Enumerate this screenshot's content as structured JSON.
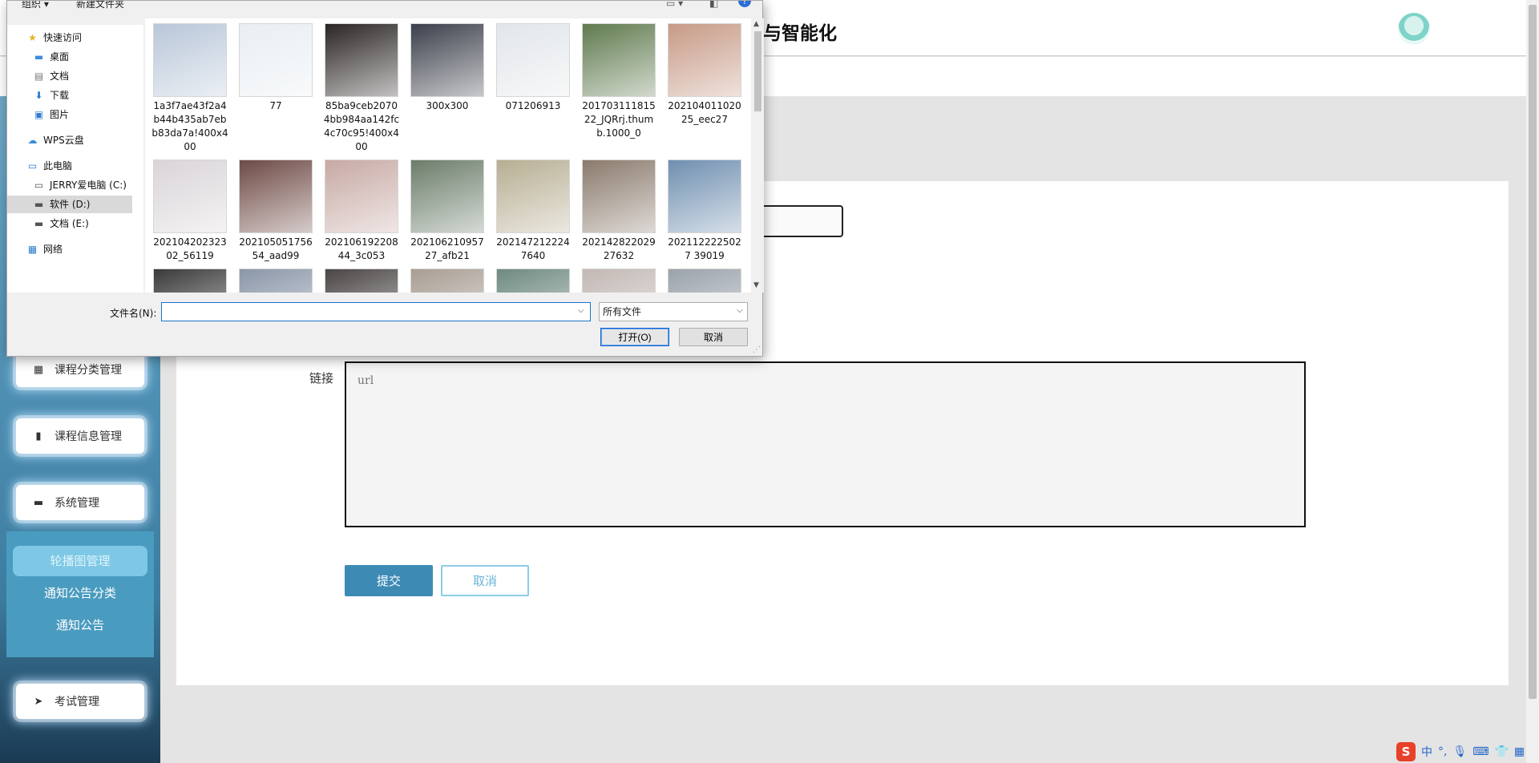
{
  "page": {
    "app_title": "与智能化"
  },
  "sidebar": {
    "items": [
      {
        "label": "课程分类管理",
        "icon": "grid-icon"
      },
      {
        "label": "课程信息管理",
        "icon": "bar-chart-icon"
      },
      {
        "label": "系统管理",
        "icon": "monitor-icon"
      },
      {
        "label": "考试管理",
        "icon": "paper-plane-icon"
      }
    ],
    "submenu": [
      {
        "label": "轮播图管理",
        "active": true
      },
      {
        "label": "通知公告分类",
        "active": false
      },
      {
        "label": "通知公告",
        "active": false
      }
    ]
  },
  "form": {
    "link_label": "链接",
    "link_placeholder": "url",
    "submit_label": "提交",
    "cancel_label": "取消"
  },
  "dialog": {
    "toolbar": {
      "organize": "组织 ▾",
      "new_folder": "新建文件夹"
    },
    "nav": {
      "quick_access": "快速访问",
      "desktop": "桌面",
      "documents": "文档",
      "downloads": "下载",
      "pictures": "图片",
      "wps_cloud": "WPS云盘",
      "this_pc": "此电脑",
      "drive_c": "JERRY爱电脑 (C:)",
      "drive_d": "软件 (D:)",
      "drive_e": "文档 (E:)",
      "network": "网络"
    },
    "files": [
      {
        "name": "1a3f7ae43f2a4b44b435ab7ebb83da7a!400x400",
        "color": "#b9c7d9"
      },
      {
        "name": "77",
        "color": "#e8eef2"
      },
      {
        "name": "85ba9ceb20704bb984aa142fc4c70c95!400x400",
        "color": "#2a2424"
      },
      {
        "name": "300x300",
        "color": "#3b3f4a"
      },
      {
        "name": "071206913",
        "color": "#e2e6ea"
      },
      {
        "name": "20170311181522_JQRrj.thumb.1000_0",
        "color": "#5f7a4e"
      },
      {
        "name": "20210401102025_eec27",
        "color": "#c79a86"
      },
      {
        "name": "20210420232302_56119",
        "color": "#d9d4d8"
      },
      {
        "name": "20210505175654_aad99",
        "color": "#6e4a45"
      },
      {
        "name": "20210619220844_3c053",
        "color": "#c7a9a4"
      },
      {
        "name": "20210621095727_afb21",
        "color": "#6b7d6a"
      },
      {
        "name": "2021472122247640",
        "color": "#b7ae92"
      },
      {
        "name": "20214282202927632",
        "color": "#8a7a6c"
      },
      {
        "name": "2021122225027 39019",
        "color": "#6f8fb0"
      },
      {
        "name": "",
        "color": "#3a3a3a"
      },
      {
        "name": "",
        "color": "#8a96a8"
      },
      {
        "name": "",
        "color": "#4a4545"
      },
      {
        "name": "",
        "color": "#a89d93"
      },
      {
        "name": "",
        "color": "#6e8a80"
      },
      {
        "name": "",
        "color": "#c2b8b4"
      },
      {
        "name": "",
        "color": "#9aa2ab"
      }
    ],
    "filename_label": "文件名(N):",
    "filename_value": "",
    "filetype": "所有文件",
    "open_label": "打开(O)",
    "cancel_label": "取消"
  },
  "ime": {
    "logo": "S",
    "mode": "中",
    "punct": "°,"
  },
  "colors": {
    "sidebar_top": "#6fa9c7",
    "submit_bg": "#3d8bb5",
    "submenu_active": "#7ec8e6"
  }
}
